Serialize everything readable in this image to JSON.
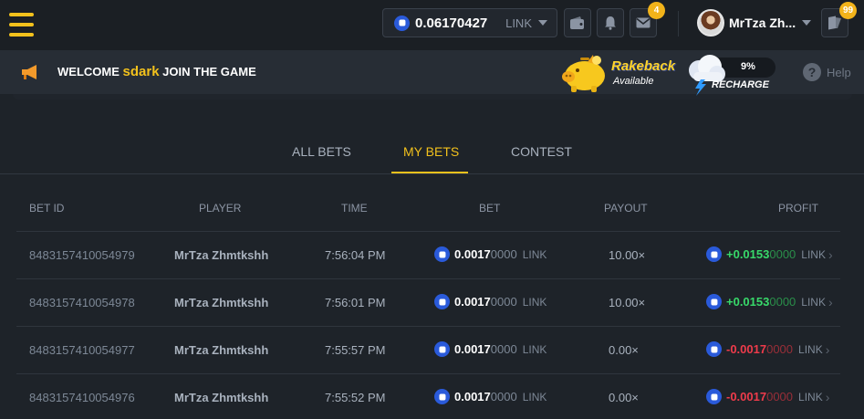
{
  "header": {
    "balance": {
      "amount": "0.06170427",
      "currency": "LINK"
    },
    "mail_badge": "4",
    "user": {
      "name": "MrTza Zh..."
    },
    "chat_badge": "99",
    "icons": [
      "menu-icon",
      "wallet-icon",
      "bell-icon",
      "mail-icon",
      "chat-icon"
    ]
  },
  "announcement": {
    "prefix": "WELCOME",
    "username": "sdark",
    "suffix": "JOIN THE GAME",
    "rakeback": {
      "title": "Rakeback",
      "status": "Available"
    },
    "recharge": {
      "label": "RECHARGE",
      "percent": "9%"
    },
    "help": "Help"
  },
  "tabs": [
    {
      "label": "ALL BETS"
    },
    {
      "label": "MY BETS",
      "active": true
    },
    {
      "label": "CONTEST"
    }
  ],
  "table": {
    "columns": [
      "BET ID",
      "PLAYER",
      "TIME",
      "BET",
      "PAYOUT",
      "PROFIT"
    ],
    "rows": [
      {
        "id": "8483157410054979",
        "player": "MrTza Zhmtkshh",
        "time": "7:56:04 PM",
        "bet_main": "0.0017",
        "bet_tail": "0000",
        "bet_cur": "LINK",
        "payout": "10.00×",
        "profit_main": "+0.0153",
        "profit_tail": "0000",
        "profit_cur": "LINK",
        "profit_sign": "pos"
      },
      {
        "id": "8483157410054978",
        "player": "MrTza Zhmtkshh",
        "time": "7:56:01 PM",
        "bet_main": "0.0017",
        "bet_tail": "0000",
        "bet_cur": "LINK",
        "payout": "10.00×",
        "profit_main": "+0.0153",
        "profit_tail": "0000",
        "profit_cur": "LINK",
        "profit_sign": "pos"
      },
      {
        "id": "8483157410054977",
        "player": "MrTza Zhmtkshh",
        "time": "7:55:57 PM",
        "bet_main": "0.0017",
        "bet_tail": "0000",
        "bet_cur": "LINK",
        "payout": "0.00×",
        "profit_main": "-0.0017",
        "profit_tail": "0000",
        "profit_cur": "LINK",
        "profit_sign": "neg"
      },
      {
        "id": "8483157410054976",
        "player": "MrTza Zhmtkshh",
        "time": "7:55:52 PM",
        "bet_main": "0.0017",
        "bet_tail": "0000",
        "bet_cur": "LINK",
        "payout": "0.00×",
        "profit_main": "-0.0017",
        "profit_tail": "0000",
        "profit_cur": "LINK",
        "profit_sign": "neg"
      }
    ]
  },
  "colors": {
    "accent": "#f2c11c",
    "positive": "#38d96a",
    "negative": "#ee3b4b",
    "coin": "#2a5ada"
  }
}
